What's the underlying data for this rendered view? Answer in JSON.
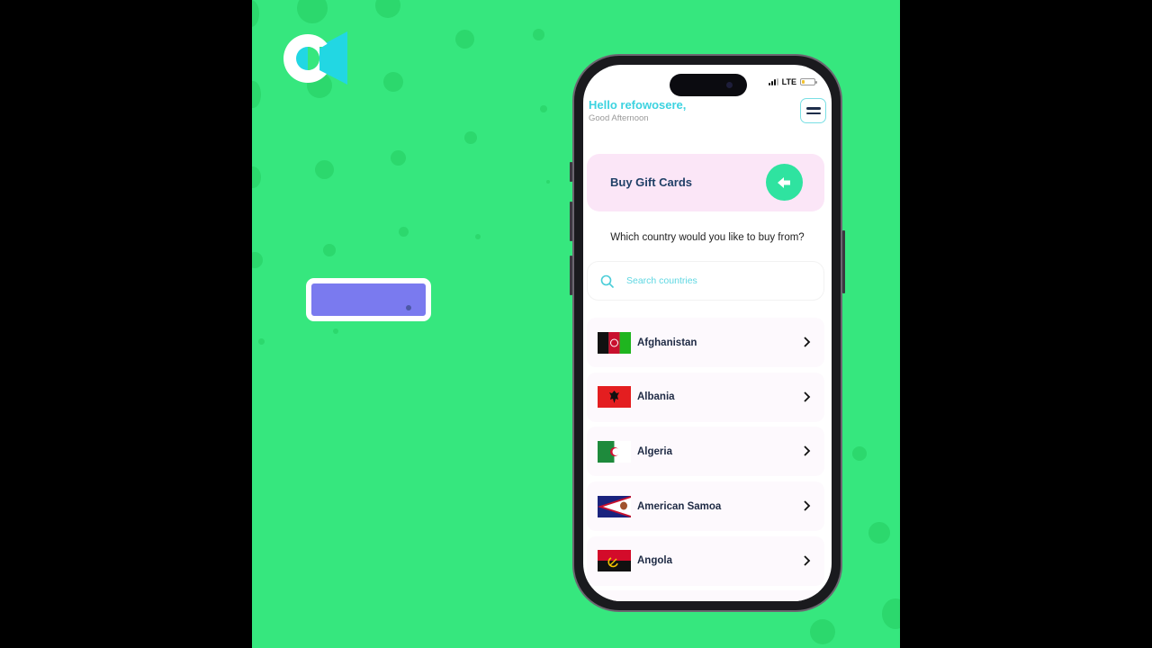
{
  "brand": {
    "logo_icon": "brand-logo-icon",
    "background_color": "#36e77e",
    "accent_cyan": "#3dd3e0",
    "accent_green": "#2fe3a0",
    "promo_button_color": "#7a7aef"
  },
  "status_bar": {
    "network": "LTE",
    "signal_icon": "signal-icon",
    "battery_icon": "battery-icon"
  },
  "header": {
    "greeting": "Hello refowosere,",
    "subtitle": "Good Afternoon",
    "menu_icon": "hamburger-menu-icon"
  },
  "banner": {
    "title": "Buy Gift Cards",
    "back_icon": "arrow-left-icon",
    "background_color": "#fbe6f7"
  },
  "question": "Which country would you like to buy from?",
  "search": {
    "placeholder": "Search countries",
    "value": "",
    "icon": "search-icon"
  },
  "countries": [
    {
      "name": "Afghanistan",
      "flag": "afghanistan-flag"
    },
    {
      "name": "Albania",
      "flag": "albania-flag"
    },
    {
      "name": "Algeria",
      "flag": "algeria-flag"
    },
    {
      "name": "American Samoa",
      "flag": "american-samoa-flag"
    },
    {
      "name": "Angola",
      "flag": "angola-flag"
    }
  ]
}
